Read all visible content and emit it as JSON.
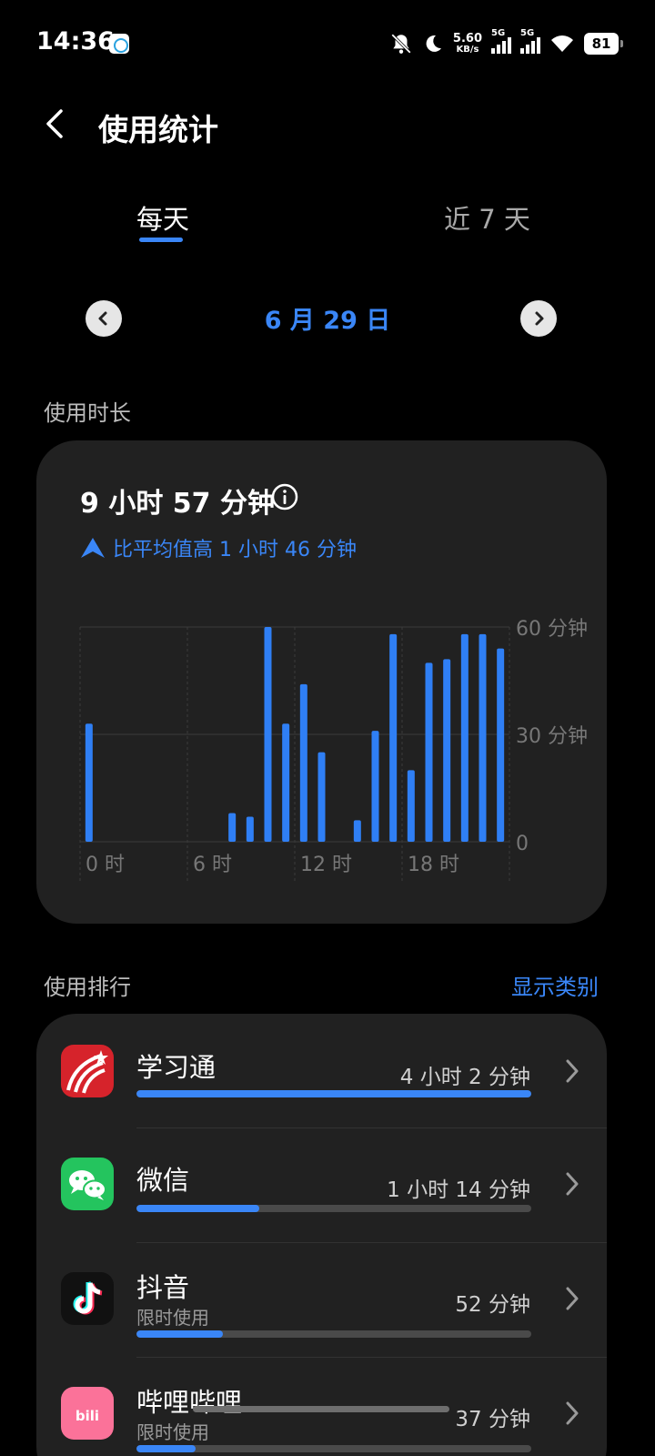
{
  "status_bar": {
    "time": "14:36",
    "net_speed": "5.60",
    "net_unit": "KB/s",
    "sim1_label": "5G",
    "sim2_label": "5G",
    "battery": "81"
  },
  "header": {
    "title": "使用统计"
  },
  "tabs": [
    {
      "label": "每天",
      "active": true
    },
    {
      "label": "近 7 天",
      "active": false
    }
  ],
  "date_nav": {
    "date": "6 月 29 日"
  },
  "usage": {
    "section_label": "使用时长",
    "total": "9 小时 57 分钟",
    "compare": "比平均值高 1 小时 46 分钟"
  },
  "chart_data": {
    "type": "bar",
    "x": [
      0,
      1,
      2,
      3,
      4,
      5,
      6,
      7,
      8,
      9,
      10,
      11,
      12,
      13,
      14,
      15,
      16,
      17,
      18,
      19,
      20,
      21,
      22,
      23
    ],
    "values": [
      33,
      0,
      0,
      0,
      0,
      0,
      0,
      0,
      8,
      7,
      60,
      33,
      44,
      25,
      0,
      6,
      31,
      58,
      20,
      50,
      51,
      58,
      58,
      54
    ],
    "unit": "分钟",
    "x_tick_labels": [
      "0 时",
      "6 时",
      "12 时",
      "18 时"
    ],
    "y_tick_labels": [
      "60 分钟",
      "30 分钟",
      "0"
    ],
    "ylim": [
      0,
      60
    ],
    "grid": true,
    "bar_color": "#2f7ff5"
  },
  "ranking": {
    "section_label": "使用排行",
    "show_category": "显示类别",
    "apps": [
      {
        "name": "学习通",
        "subtitle": "",
        "time": "4 小时 2 分钟",
        "fraction": 1.0,
        "icon": "xuexitong-icon"
      },
      {
        "name": "微信",
        "subtitle": "",
        "time": "1 小时 14 分钟",
        "fraction": 0.31,
        "icon": "wechat-icon"
      },
      {
        "name": "抖音",
        "subtitle": "限时使用",
        "time": "52 分钟",
        "fraction": 0.22,
        "icon": "douyin-icon"
      },
      {
        "name": "哔哩哔哩",
        "subtitle": "限时使用",
        "time": "37 分钟",
        "fraction": 0.15,
        "icon": "bilibili-icon"
      }
    ]
  },
  "colors": {
    "accent": "#3a86f7",
    "card": "#212121",
    "background": "#000000"
  }
}
